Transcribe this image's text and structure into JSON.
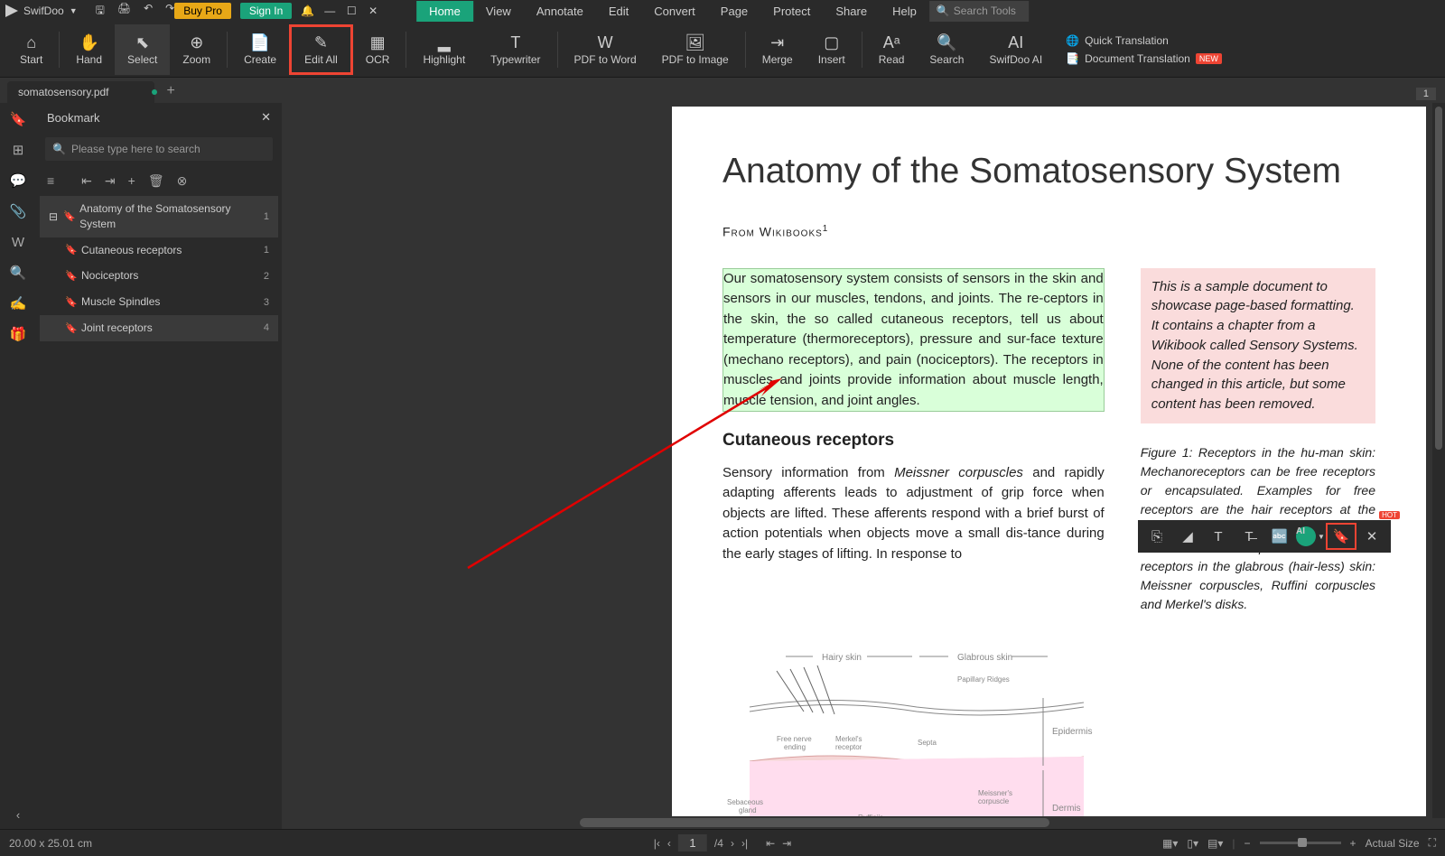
{
  "app": {
    "name": "SwifDoo"
  },
  "titlebar": {
    "menu": [
      "Home",
      "View",
      "Annotate",
      "Edit",
      "Convert",
      "Page",
      "Protect",
      "Share",
      "Help"
    ],
    "active_menu": "Home",
    "search_placeholder": "Search Tools",
    "buy": "Buy Pro",
    "signin": "Sign In"
  },
  "ribbon": {
    "buttons": [
      {
        "label": "Start",
        "icon": "⌂"
      },
      {
        "label": "Hand",
        "icon": "✋"
      },
      {
        "label": "Select",
        "icon": "⬉"
      },
      {
        "label": "Zoom",
        "icon": "⊕"
      },
      {
        "label": "Create",
        "icon": "📄"
      },
      {
        "label": "Edit All",
        "icon": "✎",
        "highlight": true
      },
      {
        "label": "OCR",
        "icon": "▦"
      },
      {
        "label": "Highlight",
        "icon": "▂"
      },
      {
        "label": "Typewriter",
        "icon": "T"
      },
      {
        "label": "PDF to Word",
        "icon": "W"
      },
      {
        "label": "PDF to Image",
        "icon": "🖼"
      },
      {
        "label": "Merge",
        "icon": "⇥"
      },
      {
        "label": "Insert",
        "icon": "▢"
      },
      {
        "label": "Read",
        "icon": "Aᵃ"
      },
      {
        "label": "Search",
        "icon": "🔍"
      },
      {
        "label": "SwifDoo AI",
        "icon": "AI"
      }
    ],
    "quick_trans": "Quick Translation",
    "doc_trans": "Document Translation",
    "new_badge": "NEW"
  },
  "tabs": {
    "open": "somatosensory.pdf",
    "pagenum": "1"
  },
  "bookmark": {
    "title": "Bookmark",
    "search_placeholder": "Please type here to search",
    "items": [
      {
        "text": "Anatomy of the Somatosensory System",
        "page": "1",
        "selected": true
      },
      {
        "text": "Cutaneous receptors",
        "page": "1"
      },
      {
        "text": "Nociceptors",
        "page": "2"
      },
      {
        "text": "Muscle Spindles",
        "page": "3"
      },
      {
        "text": "Joint receptors",
        "page": "4",
        "green": true
      }
    ]
  },
  "document": {
    "title": "Anatomy of the Somatosensory System",
    "source": "From Wikibooks",
    "source_sup": "1",
    "para1": "Our somatosensory system consists of sensors in the skin and sensors in our muscles, tendons, and joints. The re-ceptors in the skin, the so called cutaneous receptors, tell us about temperature (thermoreceptors), pressure and sur-face texture (mechano receptors), and pain (nociceptors). The receptors in muscles and joints provide information about muscle length, muscle tension, and joint angles.",
    "callout": "This is a sample document to showcase page-based formatting. It contains a chapter from a Wikibook called Sensory Systems. None of the content has been changed in this article, but some content has been removed.",
    "h2": "Cutaneous receptors",
    "para2a": "Sensory information from ",
    "para2_em": "Meissner corpuscles",
    "para2b": " and rapidly adapting afferents leads to adjustment of grip force when objects are lifted. These afferents respond with a brief burst of action potentials when objects move a small dis-tance during the early stages of lifting. In response to",
    "fig_label": "Figure 1:",
    "fig_text": "Receptors in the hu-man skin: Mechanoreceptors can be free receptors or encapsulated. Examples for free receptors are the hair receptors at the roots of hairs. Encapsulated receptors are the Pacinian corpuscles and the receptors in the glabrous (hair-less) skin: Meissner corpuscles, Ruffini corpuscles and Merkel's disks.",
    "diagram_labels": [
      "Hairy skin",
      "Glabrous skin",
      "Papillary Ridges",
      "Epidermis",
      "Dermis",
      "Free nerve ending",
      "Merkel's receptor",
      "Septa",
      "Meissner's corpuscle",
      "Ruffini's corpuscle",
      "Sebaceous gland"
    ]
  },
  "floatbar": {
    "ai": "AI",
    "hot": "HOT"
  },
  "status": {
    "dims": "20.00 x 25.01 cm",
    "page": "1",
    "total": "/4",
    "zoom": "Actual Size"
  }
}
